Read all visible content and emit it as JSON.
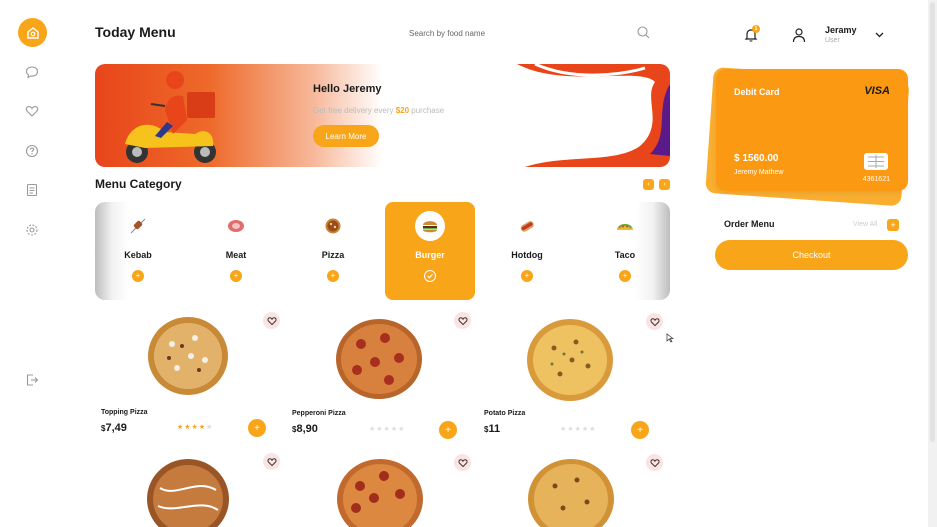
{
  "header": {
    "title": "Today Menu",
    "search_placeholder": "Search by food name",
    "notification_count": "1",
    "user_name": "Jeramy",
    "user_role": "User"
  },
  "sidebar": {
    "items": [
      "home-icon",
      "chat-icon",
      "heart-icon",
      "help-icon",
      "document-icon",
      "settings-icon",
      "logout-icon"
    ]
  },
  "banner": {
    "greeting": "Hello Jeremy",
    "sub_before": "Get free delivery every ",
    "sub_amount": "$20",
    "sub_after": " purchase",
    "button": "Learn More"
  },
  "category": {
    "title": "Menu Category",
    "items": [
      {
        "label": "Kebab",
        "icon": "kebab-icon"
      },
      {
        "label": "Meat",
        "icon": "meat-icon"
      },
      {
        "label": "Pizza",
        "icon": "pizza-icon"
      },
      {
        "label": "Burger",
        "icon": "burger-icon",
        "active": true
      },
      {
        "label": "Hotdog",
        "icon": "hotdog-icon"
      },
      {
        "label": "Taco",
        "icon": "taco-icon"
      }
    ]
  },
  "foods": [
    {
      "name": "Topping Pizza",
      "currency": "$",
      "price": "7,49",
      "rating": 4
    },
    {
      "name": "Pepperoni Pizza",
      "currency": "$",
      "price": "8,90",
      "rating": 0
    },
    {
      "name": "Potato Pizza",
      "currency": "$",
      "price": "11",
      "rating": 0
    }
  ],
  "card": {
    "title": "Debit Card",
    "brand": "VISA",
    "amount": "$ 1560.00",
    "holder": "Jeremy Mathew",
    "number": "4361621"
  },
  "order": {
    "title": "Order Menu",
    "view_all": "View All",
    "checkout": "Checkout"
  },
  "colors": {
    "accent": "#f9a51a",
    "banner_red": "#e8451a",
    "heart_bg": "#fbe3e3"
  }
}
